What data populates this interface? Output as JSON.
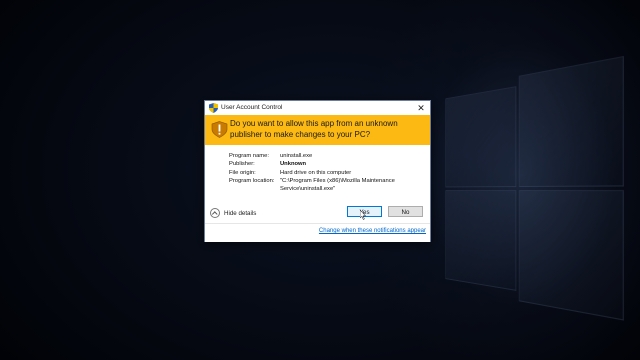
{
  "dialog": {
    "title": "User Account Control",
    "close_glyph": "✕",
    "banner": "Do you want to allow this app from an unknown publisher to make changes to your PC?",
    "fields": [
      {
        "label": "Program name:",
        "value": "uninstall.exe",
        "bold": false
      },
      {
        "label": "Publisher:",
        "value": "Unknown",
        "bold": true
      },
      {
        "label": "File origin:",
        "value": "Hard drive on this computer",
        "bold": false
      },
      {
        "label": "Program location:",
        "value": "\"C:\\Program Files (x86)\\Mozilla Maintenance Service\\uninstall.exe\"",
        "bold": false
      }
    ],
    "hide_details": "Hide details",
    "yes_label": "Yes",
    "no_label": "No",
    "change_link": "Change when these notifications appear"
  },
  "icons": {
    "title": "uac-shield-icon",
    "banner": "uac-warning-shield-icon",
    "toggle": "chevron-up-icon",
    "close": "close-icon",
    "pointer": "mouse-cursor-icon"
  },
  "colors": {
    "banner": "#fcb913",
    "link": "#0066cc",
    "default_button_border": "#0078d7"
  }
}
